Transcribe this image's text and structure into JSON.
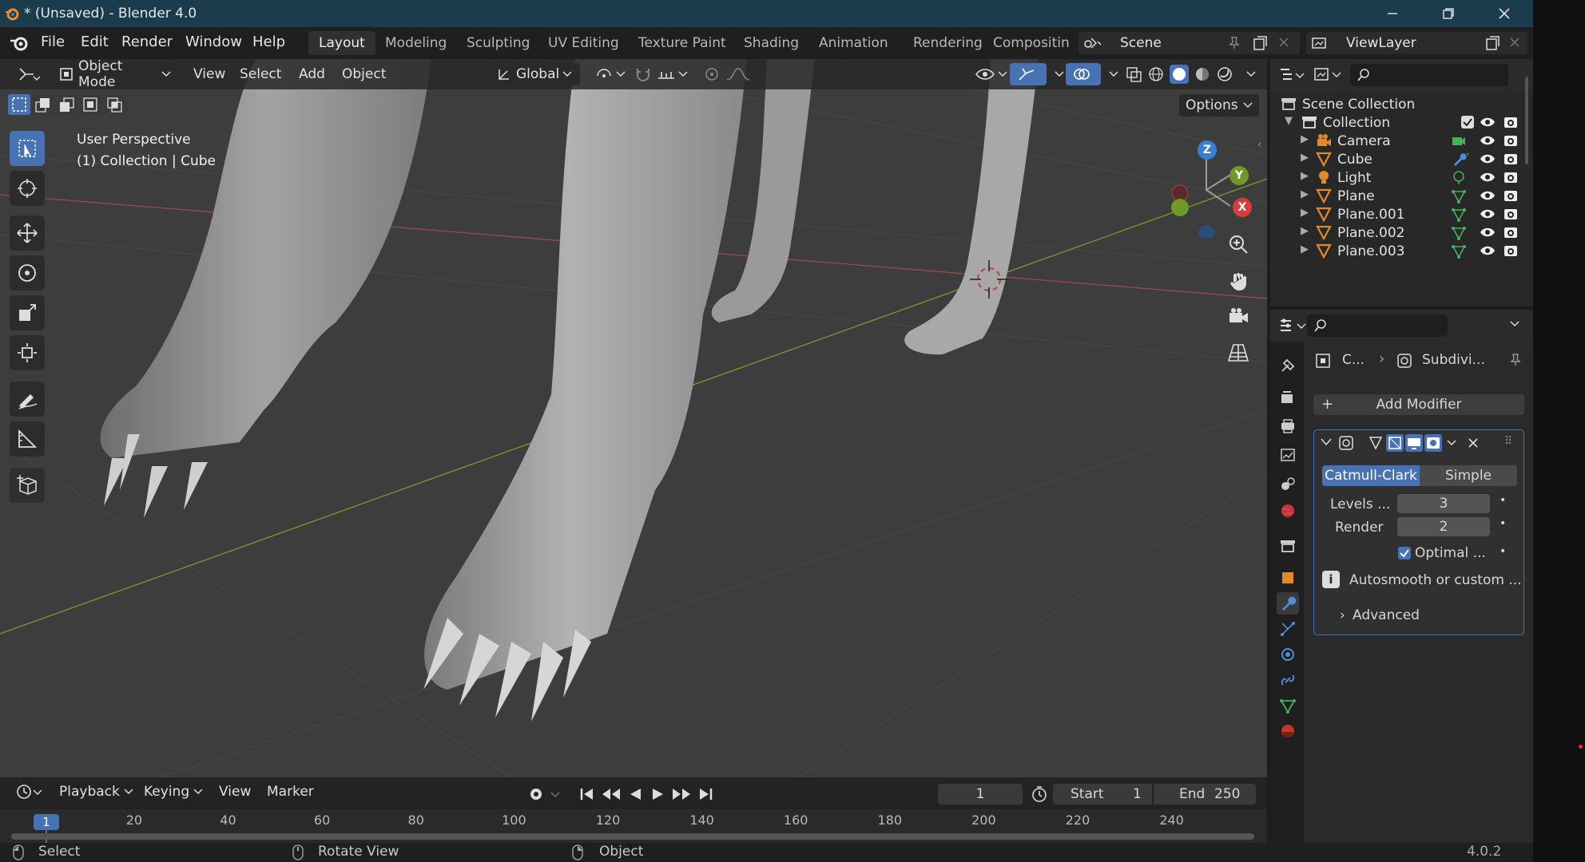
{
  "window": {
    "title": "* (Unsaved) - Blender 4.0"
  },
  "menu": {
    "file": "File",
    "edit": "Edit",
    "render": "Render",
    "window": "Window",
    "help": "Help"
  },
  "workspaces": [
    "Layout",
    "Modeling",
    "Sculpting",
    "UV Editing",
    "Texture Paint",
    "Shading",
    "Animation",
    "Rendering",
    "Compositin"
  ],
  "scene_field": "Scene",
  "viewlayer_field": "ViewLayer",
  "viewport": {
    "mode": "Object Mode",
    "menus": {
      "view": "View",
      "select": "Select",
      "add": "Add",
      "object": "Object"
    },
    "orientation": "Global",
    "options": "Options",
    "info_line1": "User Perspective",
    "info_line2": "(1) Collection | Cube",
    "gizmo": {
      "x": "X",
      "y": "Y",
      "z": "Z"
    }
  },
  "outliner": {
    "root": "Scene Collection",
    "collection": "Collection",
    "items": [
      "Camera",
      "Cube",
      "Light",
      "Plane",
      "Plane.001",
      "Plane.002",
      "Plane.003"
    ]
  },
  "properties": {
    "breadcrumb_obj": "C...",
    "breadcrumb_mod": "Subdivi...",
    "add_modifier": "Add Modifier",
    "catmull": "Catmull-Clark",
    "simple": "Simple",
    "levels_label": "Levels ...",
    "levels_value": "3",
    "render_label": "Render",
    "render_value": "2",
    "optimal": "Optimal ...",
    "info": "Autosmooth or custom ...",
    "advanced": "Advanced"
  },
  "timeline": {
    "playback": "Playback",
    "keying": "Keying",
    "view": "View",
    "marker": "Marker",
    "current_frame": "1",
    "start_label": "Start",
    "start_value": "1",
    "end_label": "End",
    "end_value": "250",
    "ticks": [
      "1",
      "20",
      "40",
      "60",
      "80",
      "100",
      "120",
      "140",
      "160",
      "180",
      "200",
      "220",
      "240"
    ]
  },
  "statusbar": {
    "select": "Select",
    "rotate": "Rotate View",
    "object": "Object",
    "version": "4.0.2"
  },
  "colors": {
    "accent": "#4772b3",
    "titlebar": "#1a3c4c",
    "axis_x": "#c83c3c",
    "axis_y": "#6f9a2a",
    "axis_z": "#3a7fd6"
  }
}
